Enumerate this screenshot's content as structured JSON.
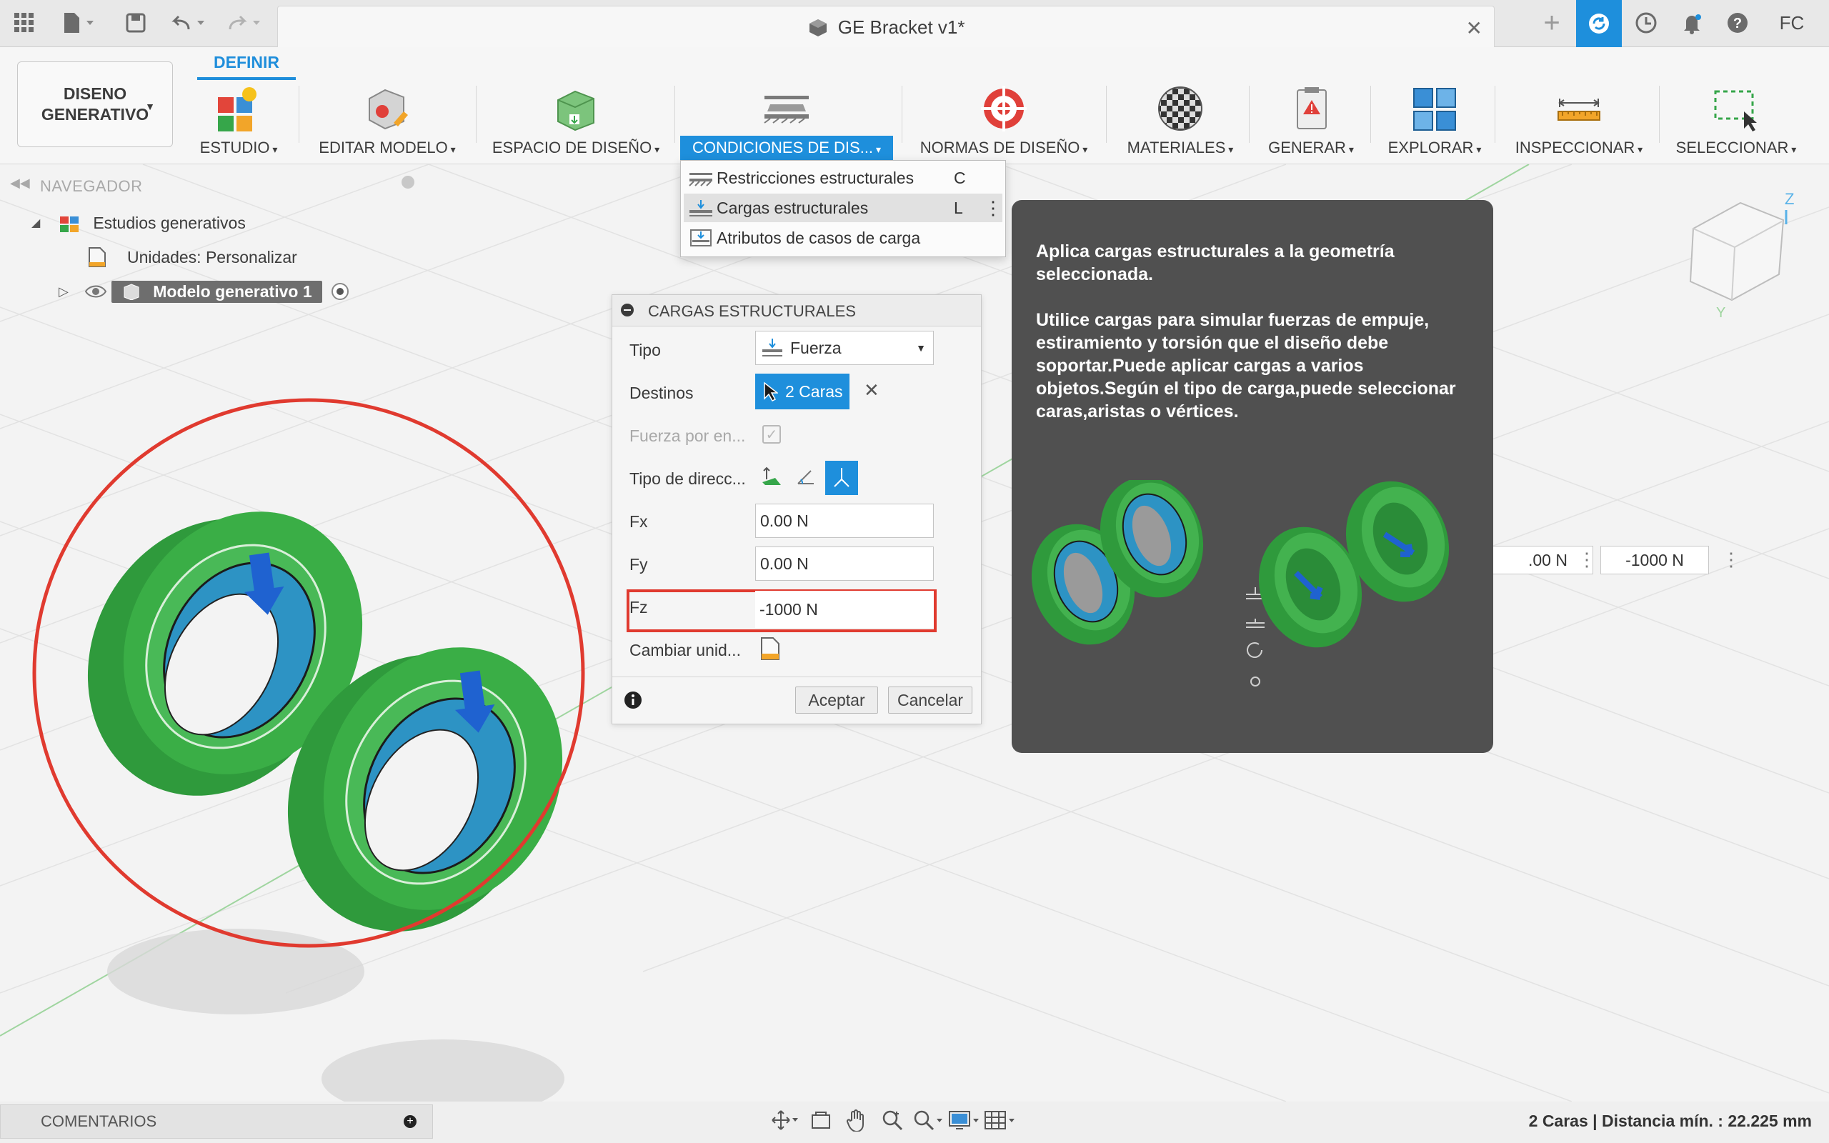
{
  "app": {
    "document_title": "GE Bracket v1*",
    "user_initials": "FC"
  },
  "ribbon": {
    "workspace_label_line1": "DISENO",
    "workspace_label_line2": "GENERATIVO",
    "active_tab": "DEFINIR",
    "tools": [
      {
        "label": "ESTUDIO",
        "icon": "study-icon"
      },
      {
        "label": "EDITAR MODELO",
        "icon": "edit-model-icon"
      },
      {
        "label": "ESPACIO DE DISEÑO",
        "icon": "design-space-icon"
      },
      {
        "label": "CONDICIONES DE DIS...",
        "icon": "design-conditions-icon",
        "active": true
      },
      {
        "label": "NORMAS DE DISEÑO",
        "icon": "design-criteria-icon"
      },
      {
        "label": "MATERIALES",
        "icon": "materials-icon"
      },
      {
        "label": "GENERAR",
        "icon": "generate-icon"
      },
      {
        "label": "EXPLORAR",
        "icon": "explore-icon"
      },
      {
        "label": "INSPECCIONAR",
        "icon": "inspect-icon"
      },
      {
        "label": "SELECCIONAR",
        "icon": "select-icon"
      }
    ]
  },
  "menu": {
    "items": [
      {
        "label": "Restricciones estructurales",
        "shortcut": "C"
      },
      {
        "label": "Cargas estructurales",
        "shortcut": "L"
      },
      {
        "label": "Atributos de casos de carga",
        "shortcut": ""
      }
    ]
  },
  "navigator": {
    "title": "NAVEGADOR",
    "root": "Estudios generativos",
    "units": "Unidades: Personalizar",
    "model": "Modelo generativo 1"
  },
  "dialog": {
    "title": "CARGAS ESTRUCTURALES",
    "tipo_label": "Tipo",
    "tipo_value": "Fuerza",
    "destinos_label": "Destinos",
    "destinos_value": "2 Caras",
    "fuerza_label": "Fuerza por en...",
    "direccion_label": "Tipo de direcc...",
    "fx_label": "Fx",
    "fx_value": "0.00 N",
    "fy_label": "Fy",
    "fy_value": "0.00 N",
    "fz_label": "Fz",
    "fz_value": "-1000 N",
    "units_label": "Cambiar unid...",
    "ok_label": "Aceptar",
    "cancel_label": "Cancelar"
  },
  "tooltip": {
    "line1": "Aplica cargas estructurales a la geometría seleccionada.",
    "line2": "Utilice cargas para simular fuerzas de empuje, estiramiento y torsión que el diseño debe soportar.Puede aplicar cargas a varios objetos.Según el tipo de carga,puede seleccionar caras,aristas o vértices."
  },
  "manipulator": {
    "value_partial": ".00 N",
    "value_fz": "-1000 N"
  },
  "statusbar": {
    "comments_label": "COMENTARIOS",
    "status": "2 Caras | Distancia mín. : 22.225 mm"
  },
  "colors": {
    "accent": "#1e8fdc",
    "ring_green": "#35a342",
    "face_blue": "#2a8bc0",
    "highlight_red": "#e03a2f"
  }
}
